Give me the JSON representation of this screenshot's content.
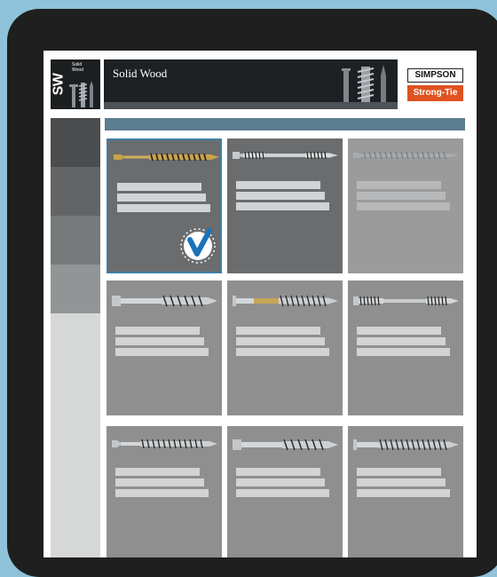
{
  "header": {
    "logo_abbrev": "SW",
    "logo_small_line1": "Solid",
    "logo_small_line2": "Wood",
    "title": "Solid Wood"
  },
  "brand": {
    "line1": "SIMPSON",
    "line2": "Strong-Tie",
    "accent_color": "#e0521f"
  },
  "sidebar": {
    "tabs": [
      {
        "color": "#4a4c4d"
      },
      {
        "color": "#626465"
      },
      {
        "color": "#777a7b"
      },
      {
        "color": "#929596"
      }
    ]
  },
  "status_bar_color": "#5c7e90",
  "products": [
    {
      "screw": "wafer-head-gold",
      "state": "selected"
    },
    {
      "screw": "long-hex-head",
      "state": "dark"
    },
    {
      "screw": "flat-head-faded",
      "state": "light"
    },
    {
      "screw": "hex-head-lag",
      "state": "normal"
    },
    {
      "screw": "washer-head-bronze",
      "state": "normal"
    },
    {
      "screw": "long-hex-head-gray",
      "state": "normal"
    },
    {
      "screw": "flat-head-gray",
      "state": "normal"
    },
    {
      "screw": "hex-head-lag-gray",
      "state": "normal"
    },
    {
      "screw": "washer-head-gray",
      "state": "normal"
    }
  ],
  "selected_icon": "checkmark-badge-icon"
}
